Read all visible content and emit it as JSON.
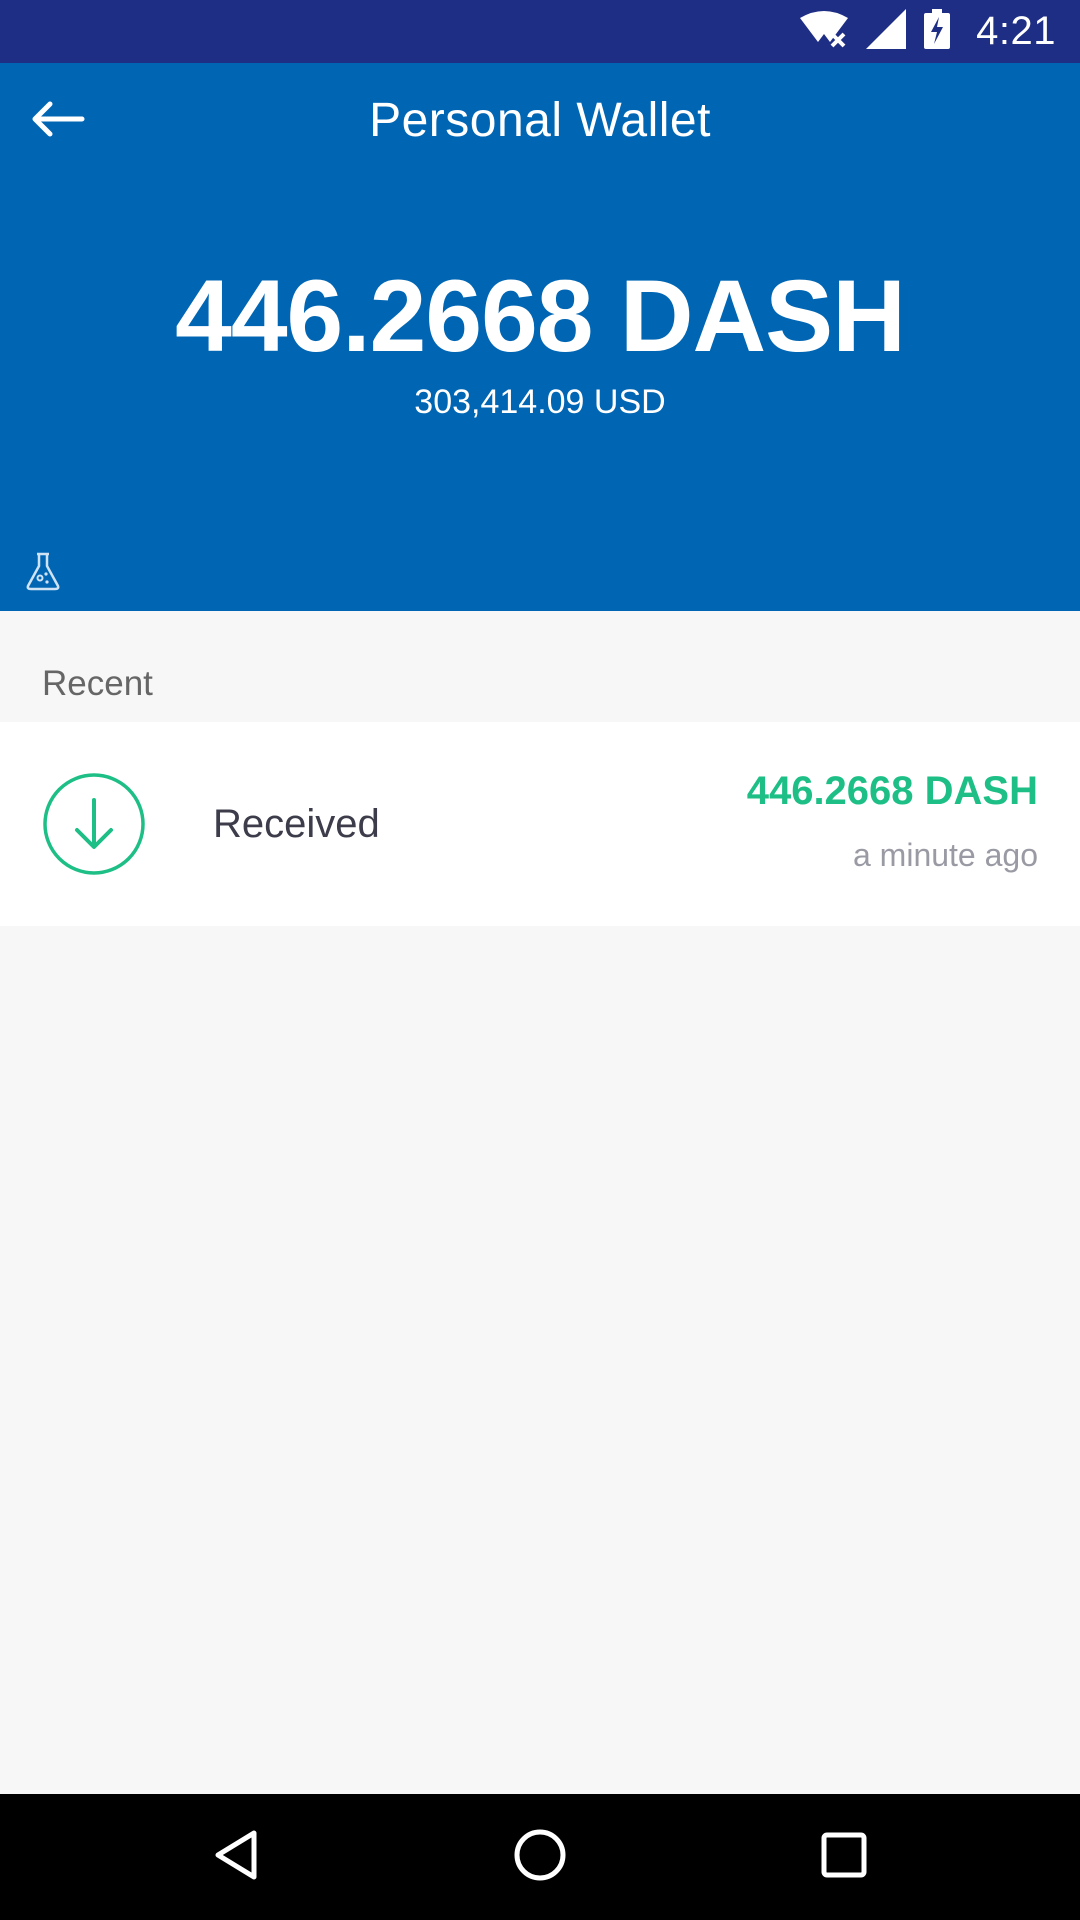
{
  "status_bar": {
    "time": "4:21",
    "icons": [
      "wifi-off-icon",
      "cell-signal-icon",
      "battery-charging-icon"
    ],
    "background_color": "#1f2e85"
  },
  "header": {
    "title": "Personal Wallet",
    "back_icon": "back-arrow-icon",
    "balance_primary": "446.2668 DASH",
    "balance_secondary": "303,414.09 USD",
    "testnet_icon": "flask-icon",
    "background_color": "#0066b4"
  },
  "recent": {
    "label": "Recent",
    "transactions": [
      {
        "type": "Received",
        "amount": "446.2668 DASH",
        "time": "a minute ago",
        "icon": "arrow-down-circle-icon",
        "accent_color": "#1dbf86"
      }
    ]
  },
  "nav_bar": {
    "buttons": [
      "back-triangle-icon",
      "home-circle-icon",
      "recents-square-icon"
    ]
  }
}
